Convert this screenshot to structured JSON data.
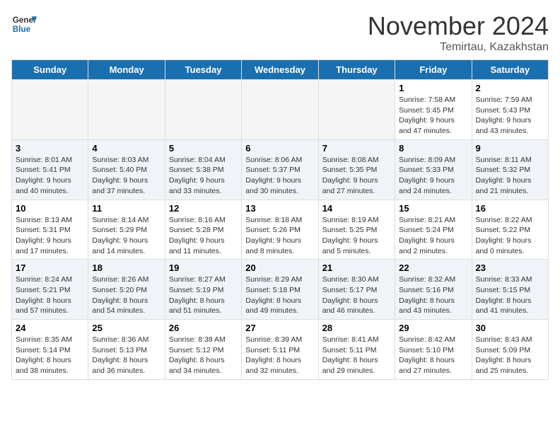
{
  "header": {
    "logo_general": "General",
    "logo_blue": "Blue",
    "month": "November 2024",
    "location": "Temirtau, Kazakhstan"
  },
  "days_of_week": [
    "Sunday",
    "Monday",
    "Tuesday",
    "Wednesday",
    "Thursday",
    "Friday",
    "Saturday"
  ],
  "weeks": [
    [
      {
        "day": "",
        "info": ""
      },
      {
        "day": "",
        "info": ""
      },
      {
        "day": "",
        "info": ""
      },
      {
        "day": "",
        "info": ""
      },
      {
        "day": "",
        "info": ""
      },
      {
        "day": "1",
        "info": "Sunrise: 7:58 AM\nSunset: 5:45 PM\nDaylight: 9 hours and 47 minutes."
      },
      {
        "day": "2",
        "info": "Sunrise: 7:59 AM\nSunset: 5:43 PM\nDaylight: 9 hours and 43 minutes."
      }
    ],
    [
      {
        "day": "3",
        "info": "Sunrise: 8:01 AM\nSunset: 5:41 PM\nDaylight: 9 hours and 40 minutes."
      },
      {
        "day": "4",
        "info": "Sunrise: 8:03 AM\nSunset: 5:40 PM\nDaylight: 9 hours and 37 minutes."
      },
      {
        "day": "5",
        "info": "Sunrise: 8:04 AM\nSunset: 5:38 PM\nDaylight: 9 hours and 33 minutes."
      },
      {
        "day": "6",
        "info": "Sunrise: 8:06 AM\nSunset: 5:37 PM\nDaylight: 9 hours and 30 minutes."
      },
      {
        "day": "7",
        "info": "Sunrise: 8:08 AM\nSunset: 5:35 PM\nDaylight: 9 hours and 27 minutes."
      },
      {
        "day": "8",
        "info": "Sunrise: 8:09 AM\nSunset: 5:33 PM\nDaylight: 9 hours and 24 minutes."
      },
      {
        "day": "9",
        "info": "Sunrise: 8:11 AM\nSunset: 5:32 PM\nDaylight: 9 hours and 21 minutes."
      }
    ],
    [
      {
        "day": "10",
        "info": "Sunrise: 8:13 AM\nSunset: 5:31 PM\nDaylight: 9 hours and 17 minutes."
      },
      {
        "day": "11",
        "info": "Sunrise: 8:14 AM\nSunset: 5:29 PM\nDaylight: 9 hours and 14 minutes."
      },
      {
        "day": "12",
        "info": "Sunrise: 8:16 AM\nSunset: 5:28 PM\nDaylight: 9 hours and 11 minutes."
      },
      {
        "day": "13",
        "info": "Sunrise: 8:18 AM\nSunset: 5:26 PM\nDaylight: 9 hours and 8 minutes."
      },
      {
        "day": "14",
        "info": "Sunrise: 8:19 AM\nSunset: 5:25 PM\nDaylight: 9 hours and 5 minutes."
      },
      {
        "day": "15",
        "info": "Sunrise: 8:21 AM\nSunset: 5:24 PM\nDaylight: 9 hours and 2 minutes."
      },
      {
        "day": "16",
        "info": "Sunrise: 8:22 AM\nSunset: 5:22 PM\nDaylight: 9 hours and 0 minutes."
      }
    ],
    [
      {
        "day": "17",
        "info": "Sunrise: 8:24 AM\nSunset: 5:21 PM\nDaylight: 8 hours and 57 minutes."
      },
      {
        "day": "18",
        "info": "Sunrise: 8:26 AM\nSunset: 5:20 PM\nDaylight: 8 hours and 54 minutes."
      },
      {
        "day": "19",
        "info": "Sunrise: 8:27 AM\nSunset: 5:19 PM\nDaylight: 8 hours and 51 minutes."
      },
      {
        "day": "20",
        "info": "Sunrise: 8:29 AM\nSunset: 5:18 PM\nDaylight: 8 hours and 49 minutes."
      },
      {
        "day": "21",
        "info": "Sunrise: 8:30 AM\nSunset: 5:17 PM\nDaylight: 8 hours and 46 minutes."
      },
      {
        "day": "22",
        "info": "Sunrise: 8:32 AM\nSunset: 5:16 PM\nDaylight: 8 hours and 43 minutes."
      },
      {
        "day": "23",
        "info": "Sunrise: 8:33 AM\nSunset: 5:15 PM\nDaylight: 8 hours and 41 minutes."
      }
    ],
    [
      {
        "day": "24",
        "info": "Sunrise: 8:35 AM\nSunset: 5:14 PM\nDaylight: 8 hours and 38 minutes."
      },
      {
        "day": "25",
        "info": "Sunrise: 8:36 AM\nSunset: 5:13 PM\nDaylight: 8 hours and 36 minutes."
      },
      {
        "day": "26",
        "info": "Sunrise: 8:38 AM\nSunset: 5:12 PM\nDaylight: 8 hours and 34 minutes."
      },
      {
        "day": "27",
        "info": "Sunrise: 8:39 AM\nSunset: 5:11 PM\nDaylight: 8 hours and 32 minutes."
      },
      {
        "day": "28",
        "info": "Sunrise: 8:41 AM\nSunset: 5:11 PM\nDaylight: 8 hours and 29 minutes."
      },
      {
        "day": "29",
        "info": "Sunrise: 8:42 AM\nSunset: 5:10 PM\nDaylight: 8 hours and 27 minutes."
      },
      {
        "day": "30",
        "info": "Sunrise: 8:43 AM\nSunset: 5:09 PM\nDaylight: 8 hours and 25 minutes."
      }
    ]
  ]
}
